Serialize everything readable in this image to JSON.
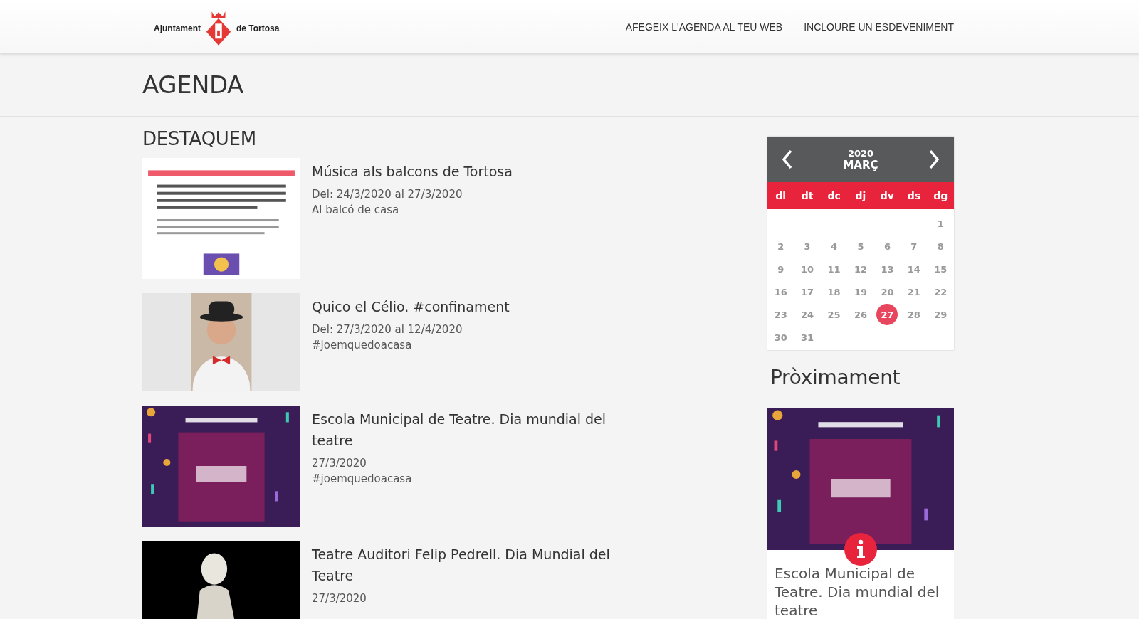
{
  "header": {
    "logo": {
      "left": "Ajuntament",
      "right": "de Tortosa"
    },
    "nav": [
      "AFEGEIX L'AGENDA AL TEU WEB",
      "INCLOURE UN ESDEVENIMENT"
    ]
  },
  "page_title": "AGENDA",
  "featured": {
    "heading": "DESTAQUEM",
    "events": [
      {
        "title": "Música als balcons de Tortosa",
        "date": "Del: 24/3/2020 al 27/3/2020",
        "place": "Al balcó de casa"
      },
      {
        "title": "Quico el Célio. #confinament",
        "date": "Del: 27/3/2020 al 12/4/2020",
        "place": "#joemquedoacasa"
      },
      {
        "title": "Escola Municipal de Teatre. Dia mundial del teatre",
        "date": "27/3/2020",
        "place": "#joemquedoacasa"
      },
      {
        "title": "Teatre Auditori Felip Pedrell. Dia Mundial del Teatre",
        "date": "27/3/2020"
      }
    ]
  },
  "calendar": {
    "year": "2020",
    "month": "MARÇ",
    "weekdays": [
      "dl",
      "dt",
      "dc",
      "dj",
      "dv",
      "ds",
      "dg"
    ],
    "weeks": [
      [
        {
          "kind": "empty"
        },
        {
          "kind": "empty"
        },
        {
          "kind": "empty"
        },
        {
          "kind": "empty"
        },
        {
          "kind": "empty"
        },
        {
          "kind": "empty"
        },
        {
          "kind": "day",
          "label": "1",
          "selected": false
        }
      ],
      [
        {
          "kind": "day",
          "label": "2",
          "selected": false
        },
        {
          "kind": "day",
          "label": "3",
          "selected": false
        },
        {
          "kind": "day",
          "label": "4",
          "selected": false
        },
        {
          "kind": "day",
          "label": "5",
          "selected": false
        },
        {
          "kind": "day",
          "label": "6",
          "selected": false
        },
        {
          "kind": "day",
          "label": "7",
          "selected": false
        },
        {
          "kind": "day",
          "label": "8",
          "selected": false
        }
      ],
      [
        {
          "kind": "day",
          "label": "9",
          "selected": false
        },
        {
          "kind": "day",
          "label": "10",
          "selected": false
        },
        {
          "kind": "day",
          "label": "11",
          "selected": false
        },
        {
          "kind": "day",
          "label": "12",
          "selected": false
        },
        {
          "kind": "day",
          "label": "13",
          "selected": false
        },
        {
          "kind": "day",
          "label": "14",
          "selected": false
        },
        {
          "kind": "day",
          "label": "15",
          "selected": false
        }
      ],
      [
        {
          "kind": "day",
          "label": "16",
          "selected": false
        },
        {
          "kind": "day",
          "label": "17",
          "selected": false
        },
        {
          "kind": "day",
          "label": "18",
          "selected": false
        },
        {
          "kind": "day",
          "label": "19",
          "selected": false
        },
        {
          "kind": "day",
          "label": "20",
          "selected": false
        },
        {
          "kind": "day",
          "label": "21",
          "selected": false
        },
        {
          "kind": "day",
          "label": "22",
          "selected": false
        }
      ],
      [
        {
          "kind": "day",
          "label": "23",
          "selected": false
        },
        {
          "kind": "day",
          "label": "24",
          "selected": false
        },
        {
          "kind": "day",
          "label": "25",
          "selected": false
        },
        {
          "kind": "day",
          "label": "26",
          "selected": false
        },
        {
          "kind": "day",
          "label": "27",
          "selected": true
        },
        {
          "kind": "day",
          "label": "28",
          "selected": false
        },
        {
          "kind": "day",
          "label": "29",
          "selected": false
        }
      ],
      [
        {
          "kind": "day",
          "label": "30",
          "selected": false
        },
        {
          "kind": "day",
          "label": "31",
          "selected": false
        }
      ]
    ]
  },
  "upcoming": {
    "heading": "Pròximament",
    "card": {
      "title": "Escola Municipal de Teatre. Dia mundial del teatre"
    }
  }
}
